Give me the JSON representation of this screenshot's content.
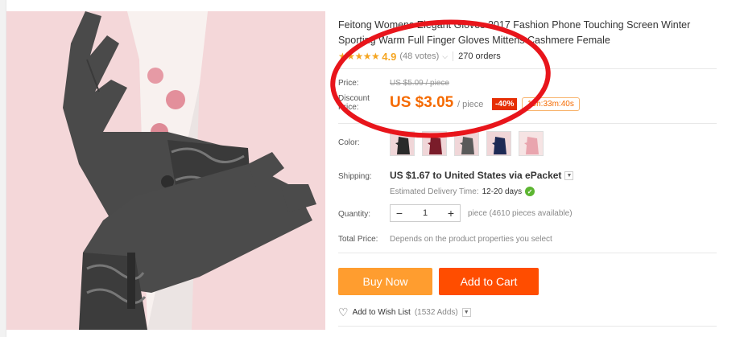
{
  "product": {
    "title": "Feitong Womens Elegant Gloves 2017 Fashion Phone Touching Screen Winter Sporting Warm Full Finger Gloves Mittens Cashmere Female",
    "rating": "4.9",
    "votes": "(48 votes)",
    "orders": "270 orders"
  },
  "price": {
    "label": "Price:",
    "original": "US $5.09 / piece",
    "discount_label_1": "Discount",
    "discount_label_2": "Price:",
    "current": "US $3.05",
    "unit": "/ piece",
    "off": "-40%",
    "countdown": "19h:33m:40s"
  },
  "color": {
    "label": "Color:",
    "swatches": [
      "black",
      "wine red",
      "gray",
      "navy blue",
      "pink"
    ]
  },
  "shipping": {
    "label": "Shipping:",
    "value": "US $1.67 to United States via ePacket",
    "eta_label": "Estimated Delivery Time:",
    "eta_value": "12-20 days"
  },
  "quantity": {
    "label": "Quantity:",
    "value": "1",
    "note": "piece (4610 pieces available)"
  },
  "total": {
    "label": "Total Price:",
    "note": "Depends on the product properties you select"
  },
  "actions": {
    "buy_now": "Buy Now",
    "add_to_cart": "Add to Cart",
    "wish_list": "Add to Wish List",
    "wish_adds": "(1532 Adds)"
  },
  "colors": {
    "accent_orange": "#f56a00",
    "buy_now_bg": "#ff9d2f",
    "add_to_cart_bg": "#ff4d00",
    "annotation_circle": "#e8151b"
  }
}
